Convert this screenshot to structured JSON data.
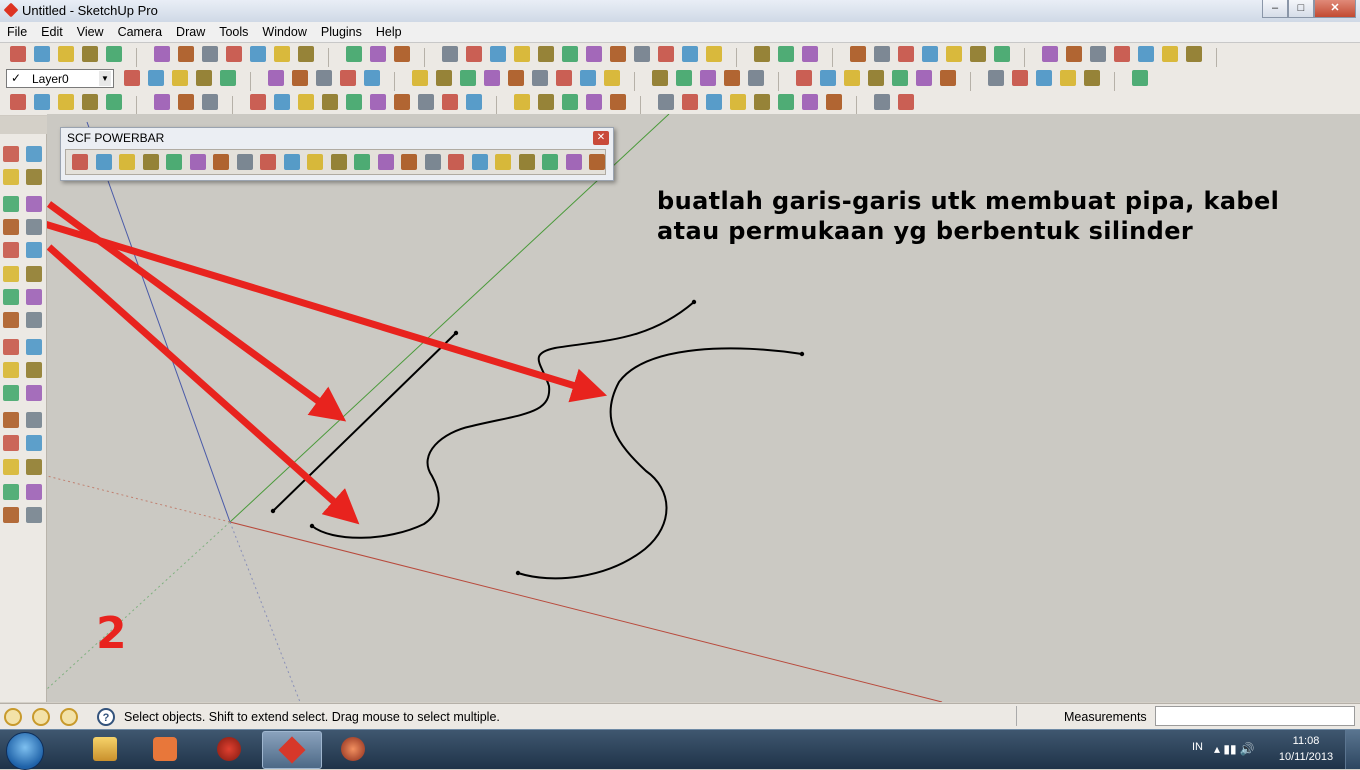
{
  "window": {
    "title": "Untitled - SketchUp Pro",
    "minimize": "–",
    "maximize": "□",
    "close": "✕"
  },
  "menu": [
    "File",
    "Edit",
    "View",
    "Camera",
    "Draw",
    "Tools",
    "Window",
    "Plugins",
    "Help"
  ],
  "layer": {
    "check": "✓",
    "value": "Layer0",
    "arrow": "▼"
  },
  "powerbar": {
    "title": "SCF POWERBAR",
    "close": "✕"
  },
  "annotation": {
    "caption_line1": "buatlah garis-garis utk membuat pipa, kabel",
    "caption_line2": "atau permukaan yg berbentuk silinder",
    "step": "2",
    "arrow_color": "#e8231e"
  },
  "axes": {
    "red": "#b84a3c",
    "green": "#4a9a3a",
    "blue": "#4a5aa8"
  },
  "status": {
    "help_icon": "?",
    "message": "Select objects. Shift to extend select. Drag mouse to select multiple.",
    "measurements_label": "Measurements",
    "measurements_value": ""
  },
  "taskbar": {
    "language": "IN",
    "tray": "▴  ▮▮  🔊",
    "time": "11:08",
    "date": "10/11/2013"
  },
  "icons": {
    "toolbar_colors": [
      "#c0392b",
      "#2e86c1",
      "#d4ac0d",
      "#7d6608",
      "#239b56",
      "#8e44ad",
      "#a04000",
      "#5d6d7e"
    ]
  }
}
